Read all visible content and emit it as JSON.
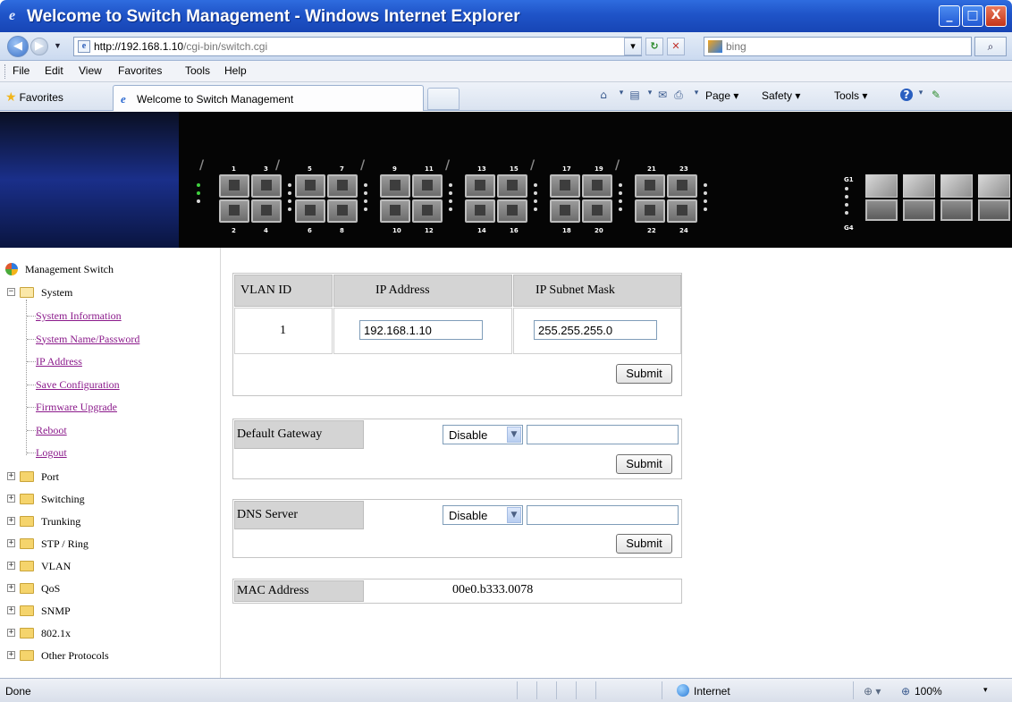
{
  "window": {
    "title": "Welcome to Switch Management - Windows Internet Explorer",
    "min_glyph": "_",
    "max_glyph": "□",
    "close_glyph": "X"
  },
  "addressbar": {
    "url_host": "http://192.168.1.10",
    "url_path": "/cgi-bin/switch.cgi",
    "refresh_glyph": "↻",
    "stop_glyph": "✕",
    "search_placeholder": "bing",
    "search_glyph": "⌕"
  },
  "menubar": [
    "File",
    "Edit",
    "View",
    "Favorites",
    "Tools",
    "Help"
  ],
  "favbar": {
    "favorites_label": "Favorites",
    "tab_label": "Welcome to Switch Management",
    "commands": [
      "Page",
      "Safety",
      "Tools"
    ]
  },
  "banner": {
    "top_numbers": [
      "1",
      "3",
      "5",
      "7",
      "9",
      "11",
      "13",
      "15",
      "17",
      "19",
      "21",
      "23"
    ],
    "bottom_numbers": [
      "2",
      "4",
      "6",
      "8",
      "10",
      "12",
      "14",
      "16",
      "18",
      "20",
      "22",
      "24"
    ],
    "g1_label": "G1",
    "g4_label": "G4"
  },
  "sidebar": {
    "root": "Management Switch",
    "system": "System",
    "system_links": [
      "System Information",
      "System Name/Password",
      "IP Address",
      "Save Configuration",
      "Firmware Upgrade",
      "Reboot",
      "Logout"
    ],
    "folders": [
      "Port",
      "Switching",
      "Trunking",
      "STP / Ring",
      "VLAN",
      "QoS",
      "SNMP",
      "802.1x",
      "Other Protocols"
    ]
  },
  "ip_table": {
    "headers": [
      "VLAN ID",
      "IP Address",
      "IP Subnet Mask"
    ],
    "vlan_id": "1",
    "ip_address": "192.168.1.10",
    "subnet_mask": "255.255.255.0",
    "submit": "Submit"
  },
  "gateway": {
    "label": "Default Gateway",
    "select_value": "Disable",
    "value": "",
    "submit": "Submit"
  },
  "dns": {
    "label": "DNS Server",
    "select_value": "Disable",
    "value": "",
    "submit": "Submit"
  },
  "mac": {
    "label": "MAC Address",
    "value": "00e0.b333.0078"
  },
  "statusbar": {
    "status": "Done",
    "zone": "Internet",
    "zoom": "100%"
  }
}
